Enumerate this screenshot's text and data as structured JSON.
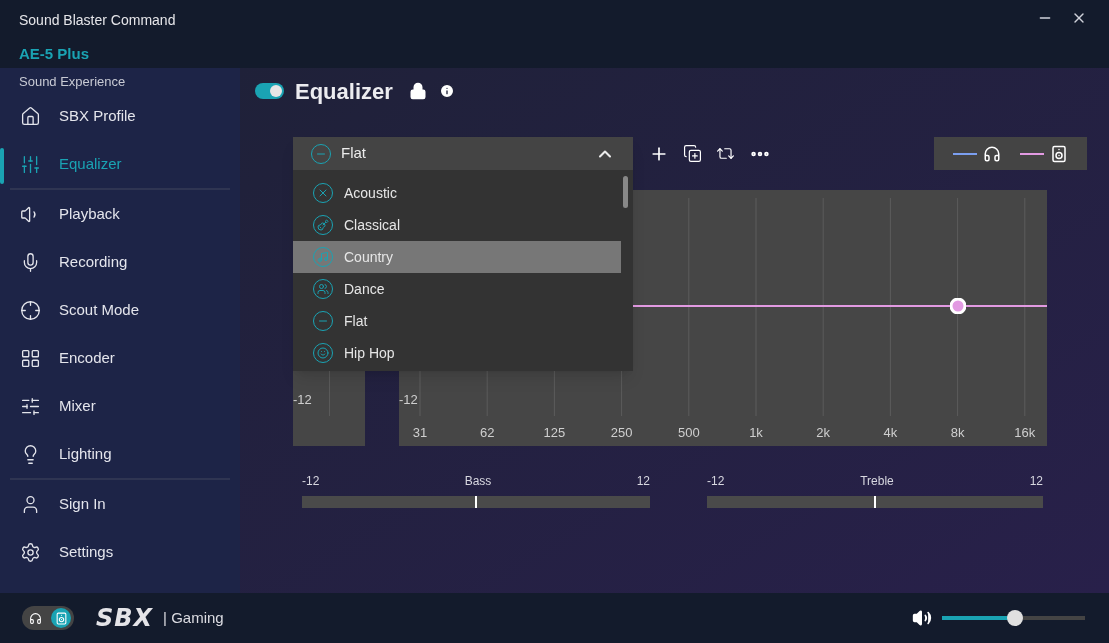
{
  "window": {
    "title": "Sound Blaster Command",
    "device": "AE-5 Plus"
  },
  "sidebar": {
    "heading": "Sound Experience",
    "groups": [
      [
        {
          "label": "SBX Profile",
          "selected": false
        },
        {
          "label": "Equalizer",
          "selected": true
        }
      ],
      [
        {
          "label": "Playback",
          "selected": false
        },
        {
          "label": "Recording",
          "selected": false
        },
        {
          "label": "Scout Mode",
          "selected": false
        },
        {
          "label": "Encoder",
          "selected": false
        },
        {
          "label": "Mixer",
          "selected": false
        },
        {
          "label": "Lighting",
          "selected": false
        }
      ],
      [
        {
          "label": "Sign In",
          "selected": false
        },
        {
          "label": "Settings",
          "selected": false
        }
      ]
    ]
  },
  "equalizer": {
    "title": "Equalizer",
    "on": true,
    "preset": {
      "value": "Flat",
      "expanded": true,
      "options": [
        {
          "label": "Acoustic",
          "highlighted": false
        },
        {
          "label": "Classical",
          "highlighted": false
        },
        {
          "label": "Country",
          "highlighted": true
        },
        {
          "label": "Dance",
          "highlighted": false
        },
        {
          "label": "Flat",
          "highlighted": false
        },
        {
          "label": "Hip Hop",
          "highlighted": false
        }
      ]
    },
    "legend": [
      {
        "kind": "headphones",
        "color": "#7b9ff0"
      },
      {
        "kind": "speakers",
        "color": "#e29ae2"
      }
    ],
    "preamp_label": "-12",
    "chart_ylabel": "-12",
    "frequencies": [
      "31",
      "62",
      "125",
      "250",
      "500",
      "1k",
      "2k",
      "4k",
      "8k",
      "16k"
    ],
    "sliders": [
      {
        "name": "Bass",
        "min": "-12",
        "max": "12",
        "level": 0.5
      },
      {
        "name": "Treble",
        "min": "-12",
        "max": "12",
        "level": 0.5
      }
    ]
  },
  "footer": {
    "outputs": [
      {
        "kind": "headphones",
        "selected": false
      },
      {
        "kind": "speakers",
        "selected": true
      }
    ],
    "logo": "SBX",
    "mode": "| Gaming",
    "volume": {
      "level": 0.51
    }
  }
}
